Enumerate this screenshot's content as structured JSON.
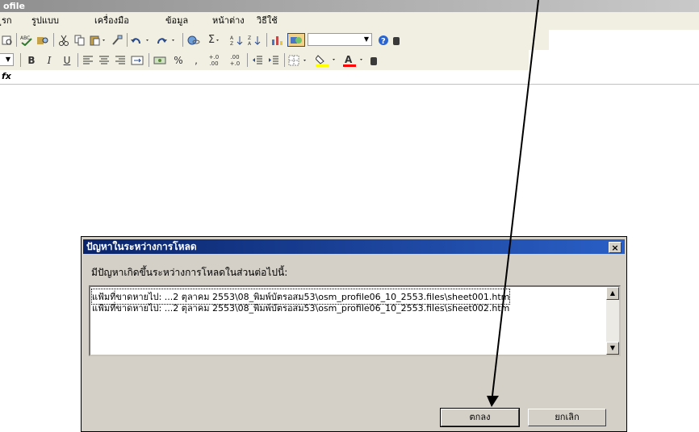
{
  "window": {
    "title": "ofile"
  },
  "menu": {
    "items": [
      "ูรก",
      "รูปแบบ",
      "เครื่องมือ",
      "ข้อมูล",
      "หน้าต่าง",
      "วิธีใช้"
    ]
  },
  "toolbar2": {
    "bold": "B",
    "italic": "I",
    "underline": "U",
    "percent": "%",
    "comma": ",",
    "inc_decimal": "+.0 .00",
    "dec_decimal": ".00 +.0"
  },
  "formula_bar": {
    "fx_label": "fx"
  },
  "dialog": {
    "title": "ปัญหาในระหว่างการโหลด",
    "message": "มีปัญหาเกิดขึ้นระหว่างการโหลดในส่วนต่อไปนี้:",
    "items": [
      "แฟ้มที่ขาดหายไป: ...2 ตุลาคม 2553\\08_พิมพ์บัตรอสม53\\osm_profile06_10_2553.files\\sheet001.htm",
      "แฟ้มที่ขาดหายไป: ...2 ตุลาคม 2553\\08_พิมพ์บัตรอสม53\\osm_profile06_10_2553.files\\sheet002.htm"
    ],
    "ok_label": "ตกลง",
    "cancel_label": "ยกเลิก",
    "close_label": "×"
  },
  "colors": {
    "dialog_title": "#0a246a",
    "dialog_bg": "#d4d0c8",
    "fill_color": "#ffff00",
    "font_color": "#ff0000"
  },
  "icons": [
    "print-preview-icon",
    "spelling-icon",
    "research-icon",
    "cut-icon",
    "copy-icon",
    "paste-icon",
    "format-painter-icon",
    "undo-icon",
    "redo-icon",
    "hyperlink-icon",
    "autosum-icon",
    "sort-asc-icon",
    "sort-desc-icon",
    "chart-icon",
    "drawing-icon",
    "help-icon",
    "align-left-icon",
    "align-center-icon",
    "align-right-icon",
    "merge-icon",
    "currency-icon",
    "indent-dec-icon",
    "indent-inc-icon",
    "borders-icon",
    "fill-color-icon",
    "font-color-icon"
  ]
}
